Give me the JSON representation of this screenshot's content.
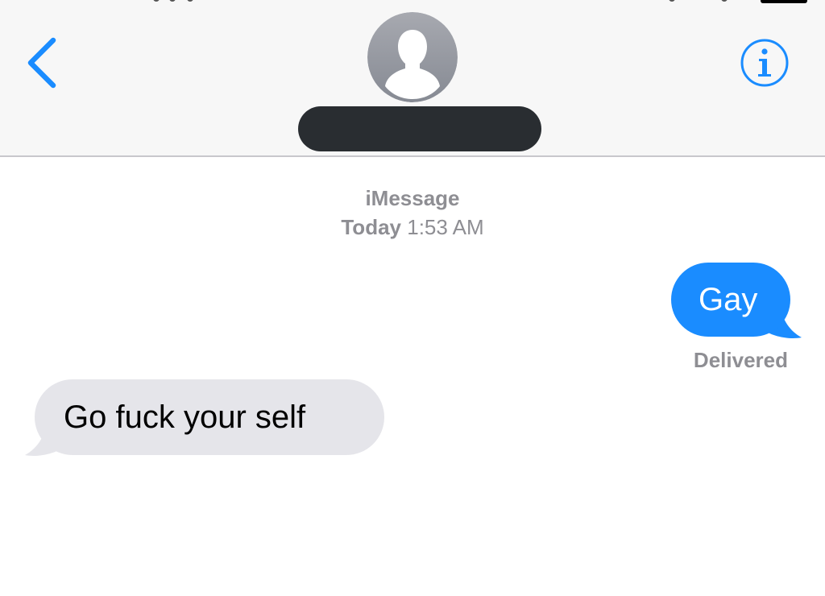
{
  "header": {
    "back_icon": "chevron-left-icon",
    "info_icon": "info-circle-icon",
    "avatar_icon": "person-silhouette-icon",
    "accent_color": "#1a8cff"
  },
  "thread": {
    "service": "iMessage",
    "day": "Today",
    "time": "1:53 AM"
  },
  "messages": [
    {
      "direction": "outgoing",
      "text": "Gay",
      "status": "Delivered",
      "bubble_color": "#1a8cff"
    },
    {
      "direction": "incoming",
      "text": "Go fuck your self",
      "bubble_color": "#e5e5ea"
    }
  ]
}
